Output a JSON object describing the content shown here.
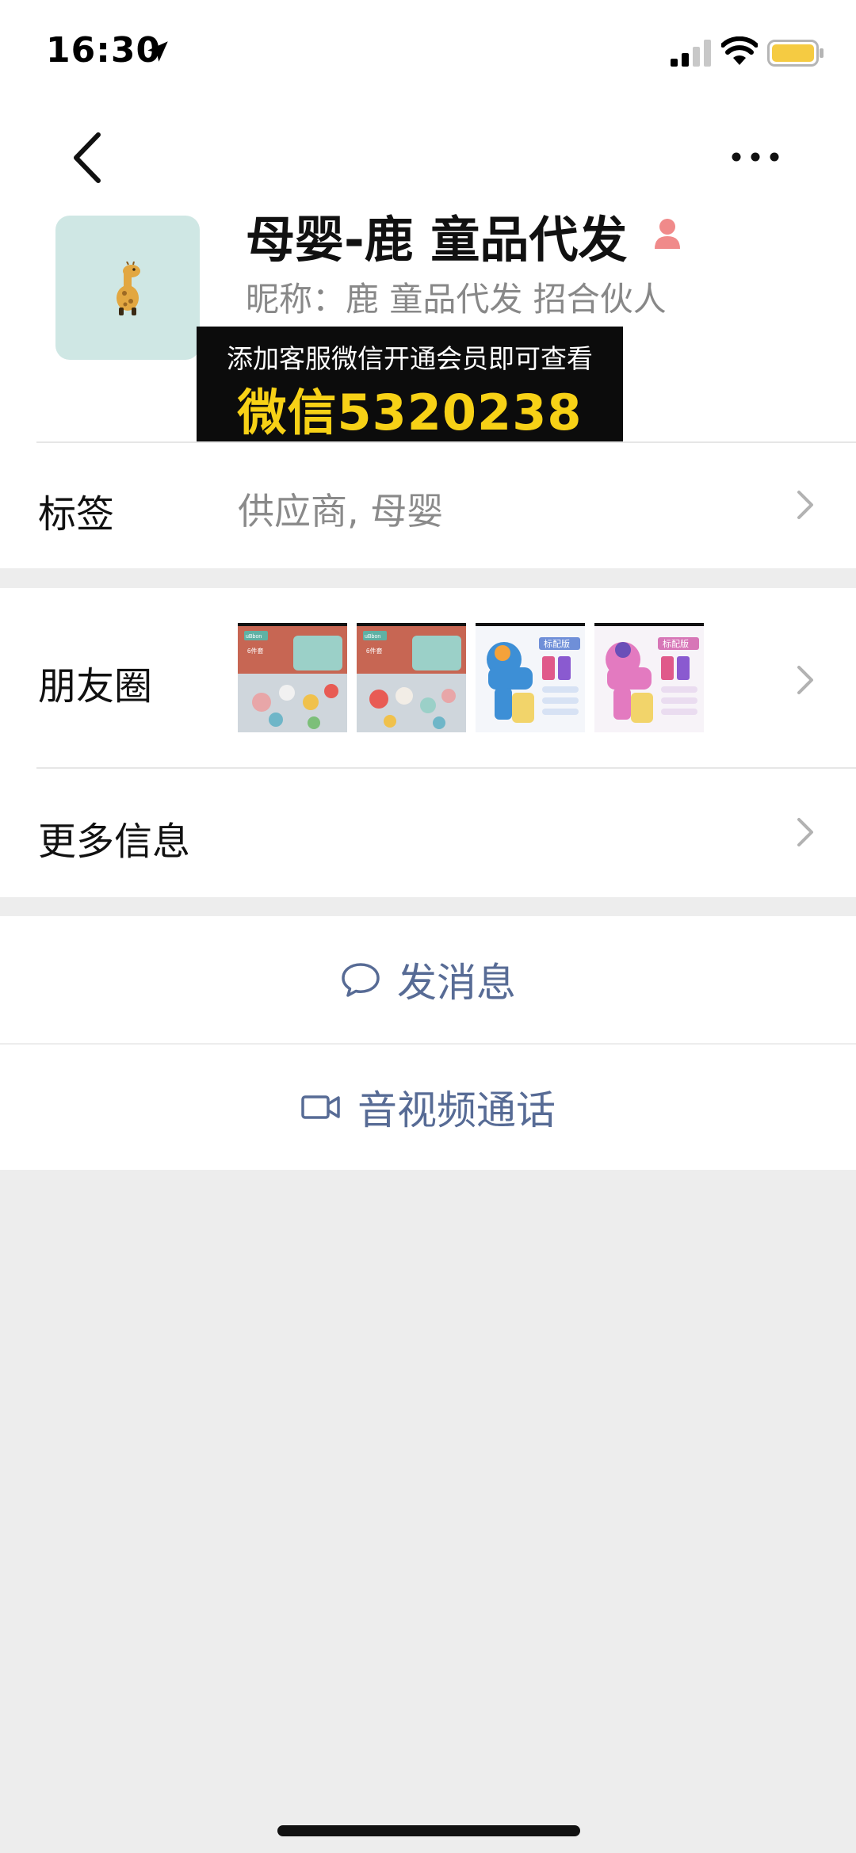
{
  "status_bar": {
    "time": "16:30"
  },
  "profile": {
    "name": "母婴-鹿 童品代发",
    "nickname": "昵称：鹿 童品代发 招合伙人",
    "gender": "female"
  },
  "banner": {
    "line1": "添加客服微信开通会员即可查看",
    "line2": "微信5320238"
  },
  "rows": {
    "tags": {
      "label": "标签",
      "value": "供应商, 母婴"
    },
    "moments": {
      "label": "朋友圈"
    },
    "more_info": {
      "label": "更多信息"
    }
  },
  "moments_thumbs": [
    {
      "brand": "uBbon",
      "sub": "6件套"
    },
    {
      "brand": "uBbon",
      "sub": "6件套"
    },
    {
      "tag": "标配版"
    },
    {
      "tag": "标配版"
    }
  ],
  "actions": {
    "message": "发消息",
    "call": "音视频通话"
  },
  "colors": {
    "link_blue": "#576b95",
    "banner_yellow": "#f7d116",
    "gender_pink": "#f08a8a",
    "avatar_bg": "#cfe7e4"
  },
  "icons": {
    "back": "chevron-left-icon",
    "more": "ellipsis-icon",
    "message": "chat-bubble-icon",
    "call": "video-camera-icon"
  }
}
